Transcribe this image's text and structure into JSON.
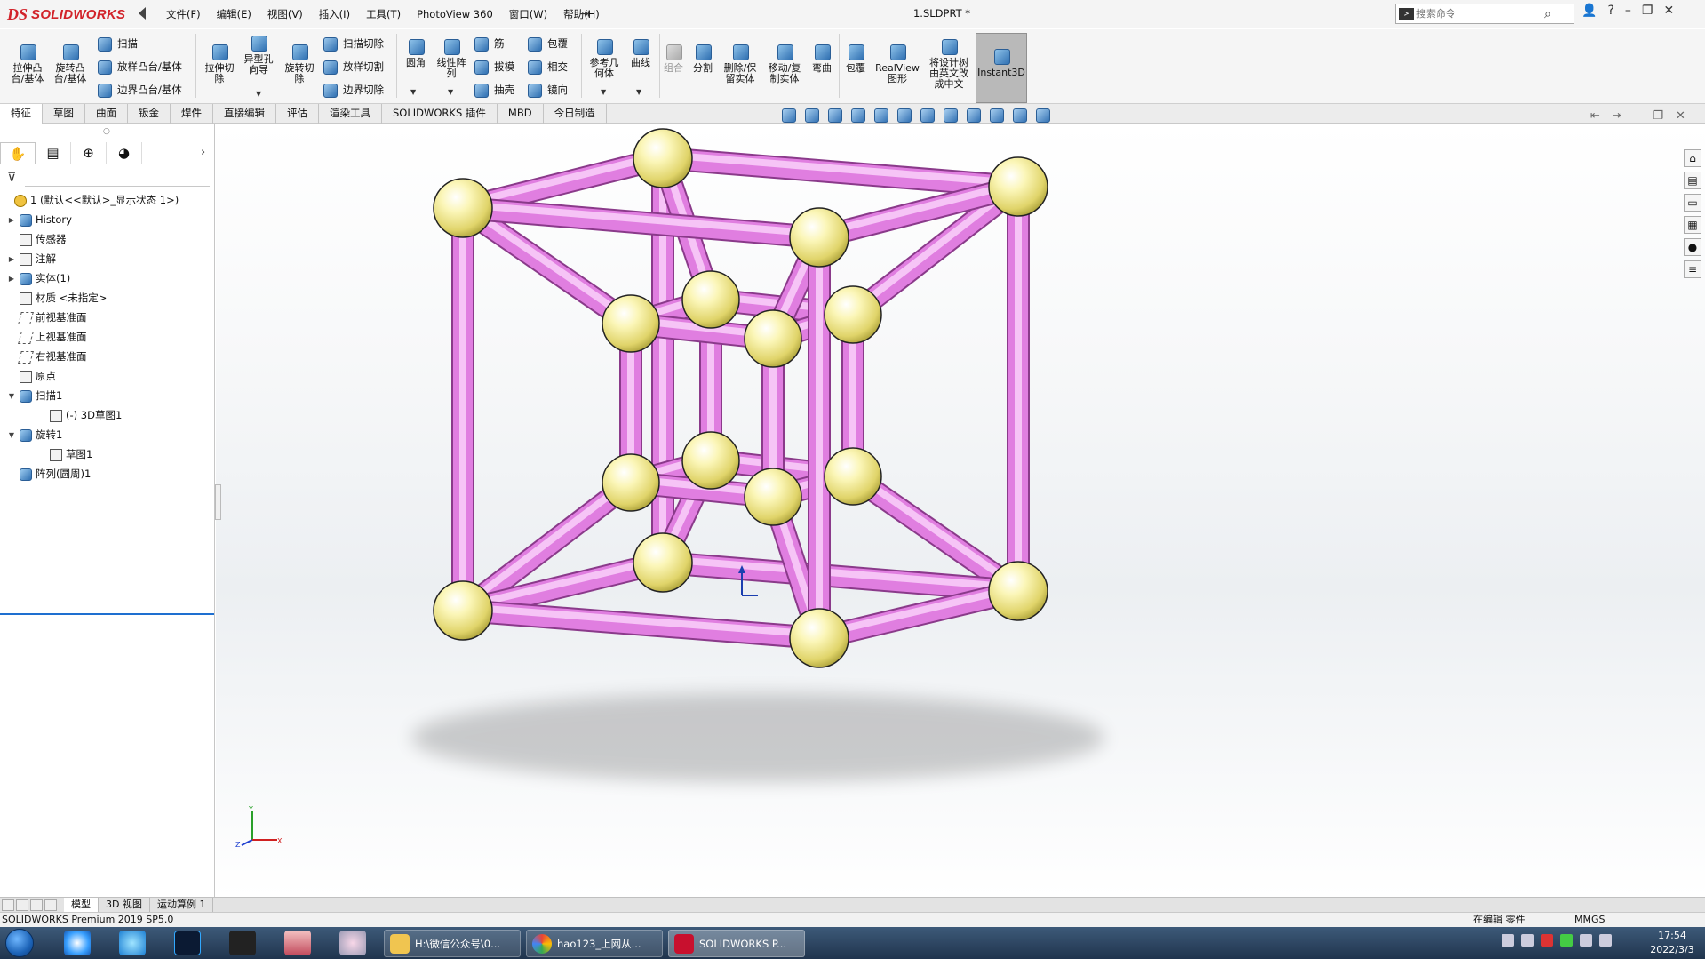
{
  "titlebar": {
    "logo_prefix": "DS",
    "logo_text": "SOLIDWORKS",
    "menu": [
      "文件(F)",
      "编辑(E)",
      "视图(V)",
      "插入(I)",
      "工具(T)",
      "PhotoView 360",
      "窗口(W)",
      "帮助(H)"
    ],
    "doc_title": "1.SLDPRT *",
    "search_placeholder": "搜索命令",
    "controls": [
      "user-icon",
      "help-icon",
      "minimize-icon",
      "restore-icon",
      "close-icon"
    ]
  },
  "ribbon": {
    "large": {
      "extrude_boss": "拉伸凸\n台/基体",
      "revolve_boss": "旋转凸\n台/基体",
      "extrude_cut": "拉伸切\n除",
      "hole_wizard": "异型孔\n向导",
      "revolve_cut": "旋转切\n除",
      "fillet": "圆角",
      "linear_pattern": "线性阵\n列",
      "ref_geometry": "参考几\n何体",
      "curves": "曲线",
      "combine": "组合",
      "split": "分割",
      "delete_body": "删除/保\n留实体",
      "move_copy": "移动/复\n制实体",
      "flex": "弯曲",
      "wrap2": "包覆",
      "realview": "RealView\n图形",
      "translate_tree": "将设计树\n由英文改\n成中文",
      "instant3d": "Instant3D"
    },
    "small": {
      "sweep": "扫描",
      "loft_boss": "放样凸台/基体",
      "boundary_boss": "边界凸台/基体",
      "swept_cut": "扫描切除",
      "lofted_cut": "放样切割",
      "boundary_cut": "边界切除",
      "rib": "筋",
      "draft": "拔模",
      "shell": "抽壳",
      "wrap": "包覆",
      "intersect": "相交",
      "mirror": "镜向"
    }
  },
  "tabs": [
    "特征",
    "草图",
    "曲面",
    "钣金",
    "焊件",
    "直接编辑",
    "评估",
    "渲染工具",
    "SOLIDWORKS 插件",
    "MBD",
    "今日制造"
  ],
  "active_tab": "特征",
  "feature_tree": [
    {
      "label": "1  (默认<<默认>_显示状态 1>)",
      "icon": "part-icon",
      "expand": "",
      "indent": 0
    },
    {
      "label": "History",
      "icon": "history-icon",
      "expand": "▶",
      "indent": 1
    },
    {
      "label": "传感器",
      "icon": "sensor-icon",
      "expand": "",
      "indent": 1
    },
    {
      "label": "注解",
      "icon": "annotation-icon",
      "expand": "▶",
      "indent": 1
    },
    {
      "label": "实体(1)",
      "icon": "solid-bodies-icon",
      "expand": "▶",
      "indent": 1
    },
    {
      "label": "材质 <未指定>",
      "icon": "material-icon",
      "expand": "",
      "indent": 1
    },
    {
      "label": "前视基准面",
      "icon": "plane-icon",
      "expand": "",
      "indent": 1
    },
    {
      "label": "上视基准面",
      "icon": "plane-icon",
      "expand": "",
      "indent": 1
    },
    {
      "label": "右视基准面",
      "icon": "plane-icon",
      "expand": "",
      "indent": 1
    },
    {
      "label": "原点",
      "icon": "origin-icon",
      "expand": "",
      "indent": 1
    },
    {
      "label": "扫描1",
      "icon": "sweep-icon",
      "expand": "▼",
      "indent": 1
    },
    {
      "label": "(-) 3D草图1",
      "icon": "3d-sketch-icon",
      "expand": "",
      "indent": 2
    },
    {
      "label": "旋转1",
      "icon": "revolve-icon",
      "expand": "▼",
      "indent": 1
    },
    {
      "label": "草图1",
      "icon": "sketch-icon",
      "expand": "",
      "indent": 2
    },
    {
      "label": "阵列(圆周)1",
      "icon": "circular-pattern-icon",
      "expand": "",
      "indent": 1
    }
  ],
  "bottom_tabs": [
    "模型",
    "3D 视图",
    "运动算例 1"
  ],
  "status": {
    "left": "SOLIDWORKS Premium 2019 SP5.0",
    "mode": "在编辑 零件",
    "units": "MMGS"
  },
  "taskbar": {
    "buttons": [
      "H:\\微信公众号\\0...",
      "hao123_上网从...",
      "SOLIDWORKS P..."
    ],
    "time": "17:54",
    "date": "2022/3/3"
  },
  "colors": {
    "rod": "#e07ee0",
    "joint": "#f3ec9a",
    "accent": "#d2232a",
    "active_blue": "#1e6fd0"
  }
}
